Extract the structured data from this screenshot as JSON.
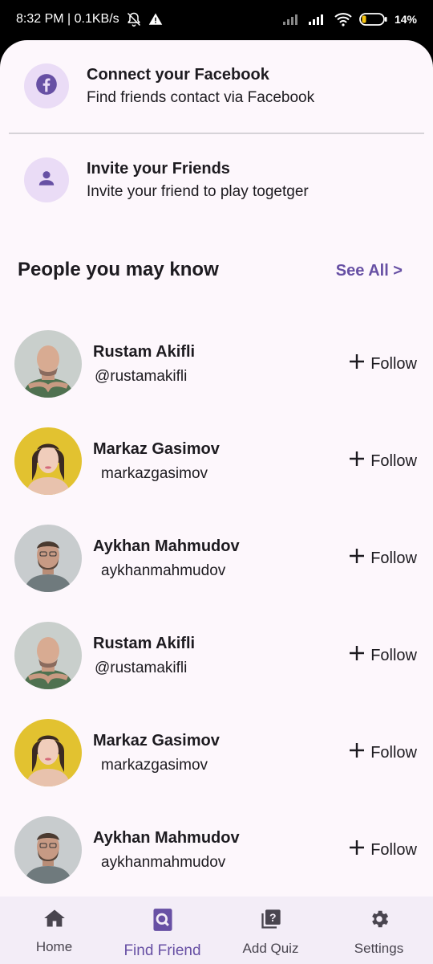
{
  "status_bar": {
    "time_speed": "8:32 PM | 0.1KB/s",
    "battery": "14%"
  },
  "options": [
    {
      "title": "Connect your Facebook",
      "subtitle": "Find friends contact via Facebook",
      "icon": "facebook-icon"
    },
    {
      "title": "Invite your Friends",
      "subtitle": "Invite your friend to play togetger",
      "icon": "person-icon"
    }
  ],
  "people_section": {
    "title": "People you may know",
    "see_all": "See All >"
  },
  "people": [
    {
      "name": "Rustam Akifli",
      "handle": "@rustamakifli",
      "follow": "Follow",
      "avatar": "bald-man"
    },
    {
      "name": "Markaz Gasimov",
      "handle": "markazgasimov",
      "follow": "Follow",
      "avatar": "woman-yellow"
    },
    {
      "name": "Aykhan Mahmudov",
      "handle": "aykhanmahmudov",
      "follow": "Follow",
      "avatar": "bearded-man"
    },
    {
      "name": "Rustam Akifli",
      "handle": "@rustamakifli",
      "follow": "Follow",
      "avatar": "bald-man"
    },
    {
      "name": "Markaz Gasimov",
      "handle": "markazgasimov",
      "follow": "Follow",
      "avatar": "woman-yellow"
    },
    {
      "name": "Aykhan Mahmudov",
      "handle": "aykhanmahmudov",
      "follow": "Follow",
      "avatar": "bearded-man"
    }
  ],
  "bottom_nav": [
    {
      "label": "Home",
      "icon": "home-icon",
      "active": false
    },
    {
      "label": "Find Friend",
      "icon": "find-friend-icon",
      "active": true
    },
    {
      "label": "Add Quiz",
      "icon": "quiz-icon",
      "active": false
    },
    {
      "label": "Settings",
      "icon": "gear-icon",
      "active": false
    }
  ],
  "colors": {
    "accent": "#6750a4",
    "sheet_background": "#fdf7fc",
    "icon_circle": "#eadcf6",
    "nav_background": "#f3edf7"
  }
}
